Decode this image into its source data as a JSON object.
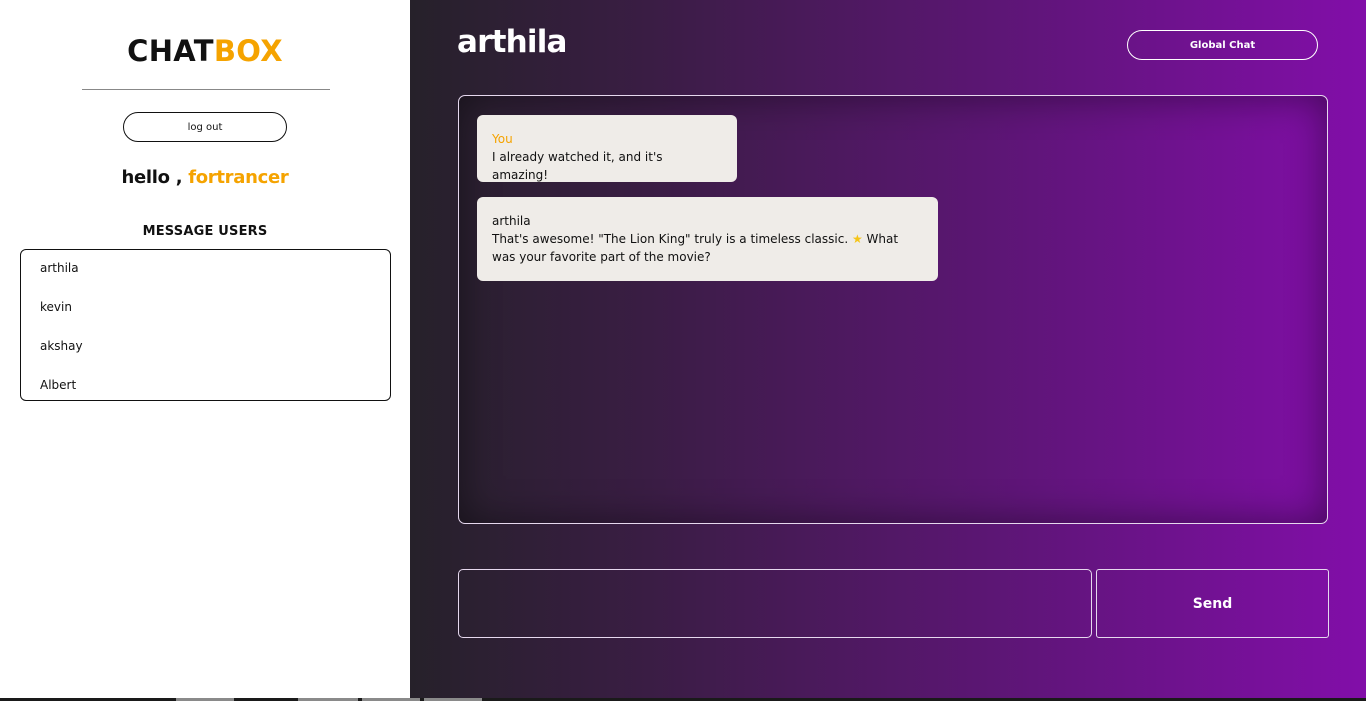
{
  "sidebar": {
    "brand_part1": "CHAT",
    "brand_part2": "BOX",
    "logout_label": "log out",
    "greeting_prefix": "hello ,",
    "username": "fortrancer",
    "section_title": "MESSAGE USERS",
    "users": [
      "arthila",
      "kevin",
      "akshay",
      "Albert"
    ]
  },
  "main": {
    "chat_title": "arthila",
    "global_chat_label": "Global Chat",
    "messages": [
      {
        "sender": "You",
        "text": "I already watched it, and it's amazing!"
      },
      {
        "sender": "arthila",
        "text_before_icon": "That's awesome! \"The Lion King\" truly is a timeless classic.",
        "icon": "star-icon",
        "text_after_icon": " What was your favorite part of the movie?"
      }
    ],
    "input_value": "",
    "send_label": "Send"
  },
  "colors": {
    "accent": "#f5a300",
    "sidebar_bg": "#ffffff",
    "gradient_start": "#26212a",
    "gradient_end": "#820ea9",
    "bubble_bg": "#efece8"
  }
}
